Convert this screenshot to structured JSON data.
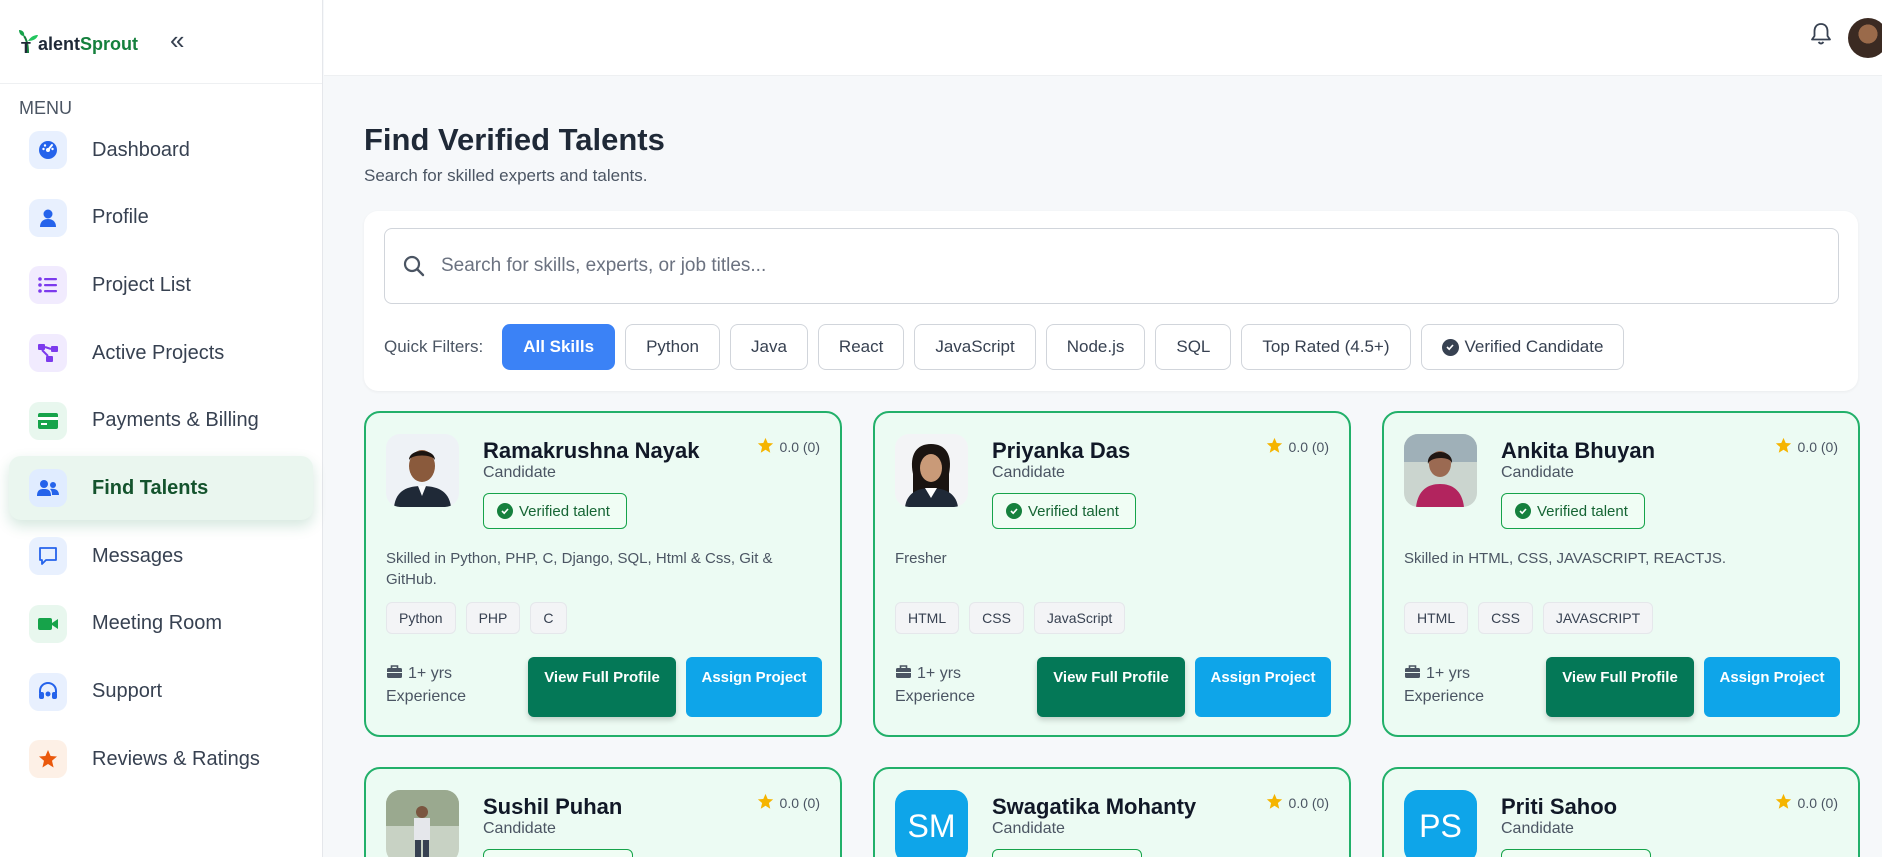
{
  "app": {
    "logo_part1": "alentSprout",
    "logo_brand_start": "T"
  },
  "sidebar": {
    "menu_title": "MENU",
    "items": [
      {
        "label": "Dashboard",
        "icon": "dashboard-icon",
        "color": "#2563eb",
        "bg": "#e8f0fe"
      },
      {
        "label": "Profile",
        "icon": "user-icon",
        "color": "#2563eb",
        "bg": "#e8f0fe"
      },
      {
        "label": "Project List",
        "icon": "list-icon",
        "color": "#7c3aed",
        "bg": "#f1ebfe"
      },
      {
        "label": "Active Projects",
        "icon": "project-diagram-icon",
        "color": "#7c3aed",
        "bg": "#f1ebfe"
      },
      {
        "label": "Payments & Billing",
        "icon": "credit-card-icon",
        "color": "#16a34a",
        "bg": "#e8f7ee"
      },
      {
        "label": "Find Talents",
        "icon": "users-icon",
        "color": "#2563eb",
        "bg": "#e0ecff",
        "active": true
      },
      {
        "label": "Messages",
        "icon": "message-icon",
        "color": "#2563eb",
        "bg": "#e8f0fe"
      },
      {
        "label": "Meeting Room",
        "icon": "video-icon",
        "color": "#16a34a",
        "bg": "#e8f7ee"
      },
      {
        "label": "Support",
        "icon": "headset-icon",
        "color": "#2563eb",
        "bg": "#e8f0fe"
      },
      {
        "label": "Reviews & Ratings",
        "icon": "star-icon",
        "color": "#ea580c",
        "bg": "#fdf0e6"
      }
    ]
  },
  "main": {
    "title": "Find Verified Talents",
    "subtitle": "Search for skilled experts and talents.",
    "search_placeholder": "Search for skills, experts, or job titles...",
    "filters_label": "Quick Filters:",
    "filters": [
      "All Skills",
      "Python",
      "Java",
      "React",
      "JavaScript",
      "Node.js",
      "SQL",
      "Top Rated (4.5+)",
      "Verified Candidate"
    ],
    "active_filter": "All Skills"
  },
  "cards": [
    {
      "name": "Ramakrushna Nayak",
      "role": "Candidate",
      "rating": "0.0 (0)",
      "verified": "Verified talent",
      "desc": "Skilled in Python, PHP, C, Django, SQL, Html & Css, Git & GitHub.",
      "skills": [
        "Python",
        "PHP",
        "C"
      ],
      "exp_years": "1+ yrs",
      "exp_label": "Experience",
      "view_btn": "View Full Profile",
      "assign_btn": "Assign Project",
      "photo": "photo-1"
    },
    {
      "name": "Priyanka Das",
      "role": "Candidate",
      "rating": "0.0 (0)",
      "verified": "Verified talent",
      "desc": "Fresher",
      "skills": [
        "HTML",
        "CSS",
        "JavaScript"
      ],
      "exp_years": "1+ yrs",
      "exp_label": "Experience",
      "view_btn": "View Full Profile",
      "assign_btn": "Assign Project",
      "photo": "photo-2"
    },
    {
      "name": "Ankita Bhuyan",
      "role": "Candidate",
      "rating": "0.0 (0)",
      "verified": "Verified talent",
      "desc": "Skilled in HTML, CSS, JAVASCRIPT, REACTJS.",
      "skills": [
        "HTML",
        "CSS",
        "JAVASCRIPT"
      ],
      "exp_years": "1+ yrs",
      "exp_label": "Experience",
      "view_btn": "View Full Profile",
      "assign_btn": "Assign Project",
      "photo": "photo-3"
    },
    {
      "name": "Sushil Puhan",
      "role": "Candidate",
      "rating": "0.0 (0)",
      "photo": "photo-4"
    },
    {
      "name": "Swagatika Mohanty",
      "role": "Candidate",
      "rating": "0.0 (0)",
      "initials": "SM"
    },
    {
      "name": "Priti Sahoo",
      "role": "Candidate",
      "rating": "0.0 (0)",
      "initials": "PS"
    }
  ]
}
